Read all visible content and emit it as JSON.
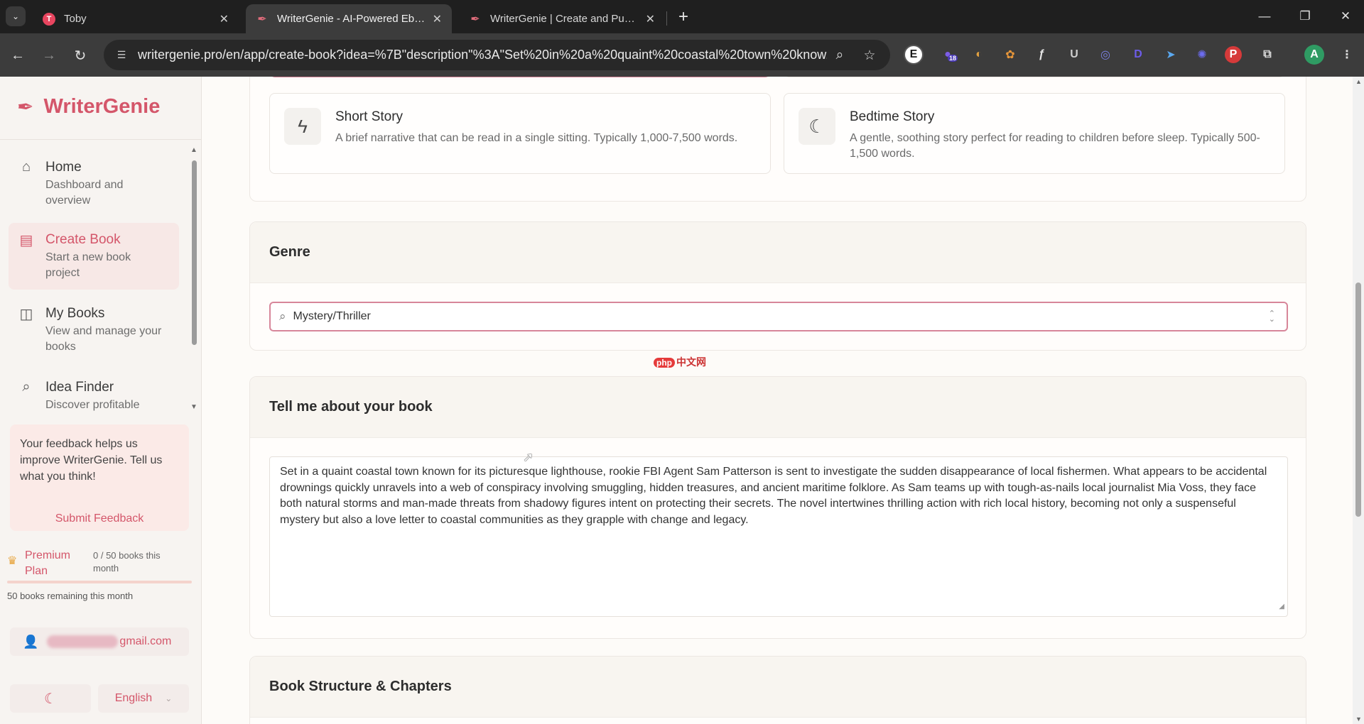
{
  "browser": {
    "tabs": [
      {
        "title": "Toby",
        "favicon": "toby-icon",
        "active": false
      },
      {
        "title": "WriterGenie - AI-Powered Ebook",
        "favicon": "quill-icon",
        "active": true
      },
      {
        "title": "WriterGenie | Create and Publish",
        "favicon": "quill-icon",
        "active": false
      }
    ],
    "url": "writergenie.pro/en/app/create-book?idea=%7B\"description\"%3A\"Set%20in%20a%20quaint%20coastal%20town%20know...",
    "extension_badge": "18",
    "profile_initial": "A"
  },
  "sidebar": {
    "brand": "WriterGenie",
    "nav": [
      {
        "title": "Home",
        "desc": "Dashboard and overview",
        "icon": "home-icon"
      },
      {
        "title": "Create Book",
        "desc": "Start a new book project",
        "icon": "book-icon",
        "active": true
      },
      {
        "title": "My Books",
        "desc": "View and manage your books",
        "icon": "open-book-icon"
      },
      {
        "title": "Idea Finder",
        "desc": "Discover profitable",
        "icon": "search-icon"
      }
    ],
    "feedback": {
      "message": "Your feedback helps us improve WriterGenie. Tell us what you think!",
      "button": "Submit Feedback"
    },
    "plan": {
      "name": "Premium Plan",
      "count": "0 / 50 books this month",
      "used_fraction": 0,
      "remaining": "50 books remaining this month"
    },
    "user": {
      "email_suffix": "gmail.com"
    },
    "language": "English"
  },
  "main": {
    "book_types": [
      {
        "title": "Short Story",
        "desc": "A brief narrative that can be read in a single sitting. Typically 1,000-7,500 words.",
        "icon": "lightning-icon"
      },
      {
        "title": "Bedtime Story",
        "desc": "A gentle, soothing story perfect for reading to children before sleep. Typically 500-1,500 words.",
        "icon": "moon-icon"
      }
    ],
    "genre": {
      "heading": "Genre",
      "value": "Mystery/Thriller"
    },
    "about": {
      "heading": "Tell me about your book",
      "text": "Set in a quaint coastal town known for its picturesque lighthouse, rookie FBI Agent Sam Patterson is sent to investigate the sudden disappearance of local fishermen. What appears to be accidental drownings quickly unravels into a web of conspiracy involving smuggling, hidden treasures, and ancient maritime folklore. As Sam teams up with tough-as-nails local journalist Mia Voss, they face both natural storms and man-made threats from shadowy figures intent on protecting their secrets. The novel intertwines thrilling action with rich local history, becoming not only a suspenseful mystery but also a love letter to coastal communities as they grapple with change and legacy."
    },
    "structure": {
      "heading": "Book Structure & Chapters"
    },
    "watermark": {
      "badge": "php",
      "text": "中文网"
    }
  },
  "colors": {
    "accent": "#d4566a",
    "sidebar_bg": "#f7f4f1",
    "chrome_bg": "#1f1f1f"
  }
}
